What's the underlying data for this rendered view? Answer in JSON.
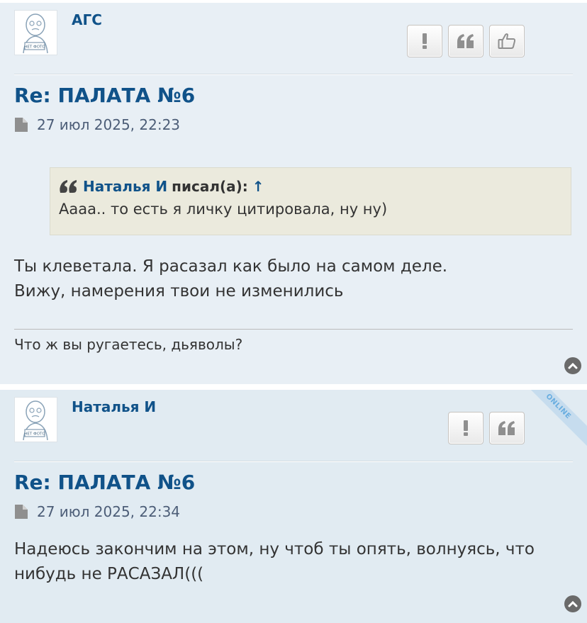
{
  "posts": [
    {
      "author": "АГС",
      "avatar_label": "НЕТ ФОТО",
      "title": "Re: ПАЛАТА №6",
      "date": "27 июл 2025, 22:23",
      "quote": {
        "author": "Наталья И",
        "wrote": "писал(а):",
        "arrow": "↑",
        "text": "Аааа.. то есть я личку цитировала, ну ну)"
      },
      "content_lines": [
        "Ты клеветала. Я расазал как было на самом деле.",
        "Вижу, намерения твои не изменились"
      ],
      "signature": "Что ж вы ругаетесь, дьяволы?",
      "buttons": [
        "report-icon",
        "quote-icon",
        "like-icon"
      ]
    },
    {
      "author": "Наталья И",
      "avatar_label": "НЕТ ФОТО",
      "online_badge": "ONLINE",
      "title": "Re: ПАЛАТА №6",
      "date": "27 июл 2025, 22:34",
      "content_lines": [
        "Надеюсь закончим на этом, ну чтоб ты опять, волнуясь, что",
        "нибудь не РАСАЗАЛ((("
      ],
      "buttons": [
        "report-icon",
        "quote-icon"
      ]
    }
  ],
  "colors": {
    "link": "#105289",
    "post_bg_1": "#e8eff5",
    "post_bg_2": "#e1ebf2",
    "quote_bg": "#ebeadd"
  }
}
